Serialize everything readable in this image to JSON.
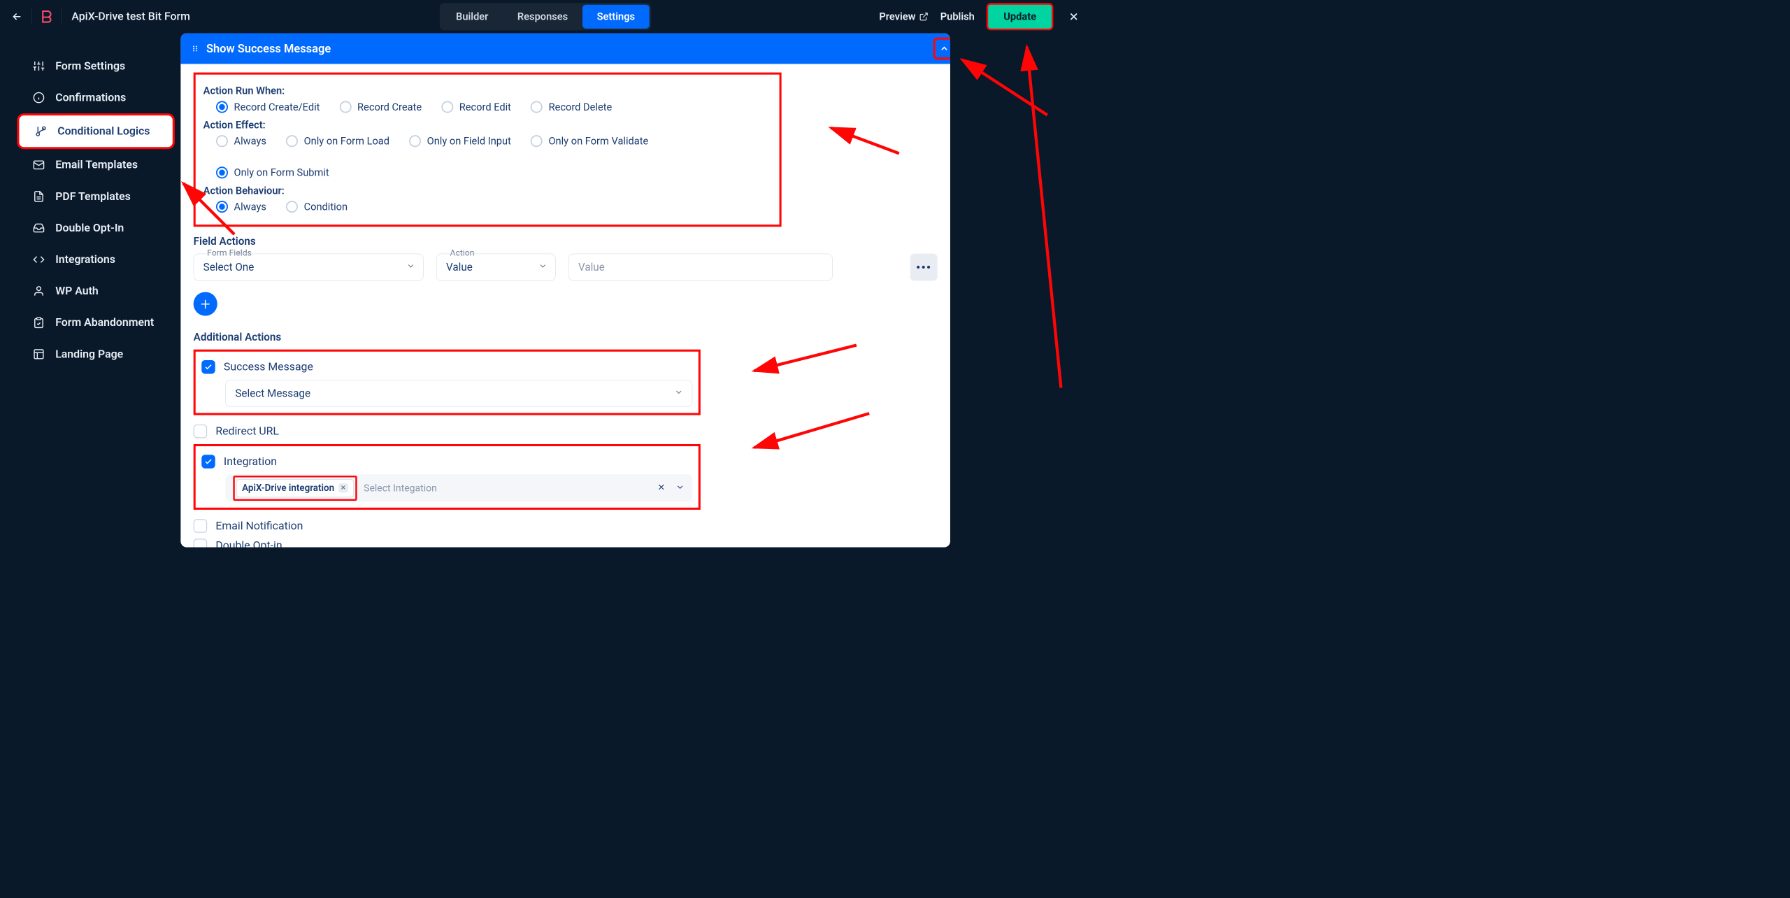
{
  "header": {
    "page_title": "ApiX-Drive test Bit Form",
    "tabs": [
      "Builder",
      "Responses",
      "Settings"
    ],
    "active_tab": 2,
    "preview": "Preview",
    "publish": "Publish",
    "update": "Update"
  },
  "sidebar": {
    "items": [
      {
        "label": "Form Settings"
      },
      {
        "label": "Confirmations"
      },
      {
        "label": "Conditional Logics"
      },
      {
        "label": "Email Templates"
      },
      {
        "label": "PDF Templates"
      },
      {
        "label": "Double Opt-In"
      },
      {
        "label": "Integrations"
      },
      {
        "label": "WP Auth"
      },
      {
        "label": "Form Abandonment"
      },
      {
        "label": "Landing Page"
      }
    ],
    "active_index": 2
  },
  "panel": {
    "title": "Show Success Message",
    "labels": {
      "run_when": "Action Run When:",
      "effect": "Action Effect:",
      "behaviour": "Action Behaviour:",
      "field_actions": "Field Actions",
      "form_fields": "Form Fields",
      "action": "Action",
      "additional": "Additional Actions"
    },
    "run_when": {
      "options": [
        "Record Create/Edit",
        "Record Create",
        "Record Edit",
        "Record Delete"
      ],
      "selected": 0
    },
    "effect": {
      "options": [
        "Always",
        "Only on Form Load",
        "Only on Field Input",
        "Only on Form Validate",
        "Only on Form Submit"
      ],
      "selected": 4
    },
    "behaviour": {
      "options": [
        "Always",
        "Condition"
      ],
      "selected": 0
    },
    "field_actions": {
      "form_fields_value": "Select One",
      "action_value": "Value",
      "value_placeholder": "Value"
    },
    "additional": {
      "success_message": {
        "label": "Success Message",
        "checked": true,
        "select_value": "Select Message"
      },
      "redirect_url": {
        "label": "Redirect URL",
        "checked": false
      },
      "integration": {
        "label": "Integration",
        "checked": true,
        "chip": "ApiX-Drive integration",
        "placeholder": "Select Integation"
      },
      "email_notification": {
        "label": "Email Notification",
        "checked": false
      },
      "double_opt_in": {
        "label": "Double Opt-in",
        "checked": false
      }
    }
  }
}
